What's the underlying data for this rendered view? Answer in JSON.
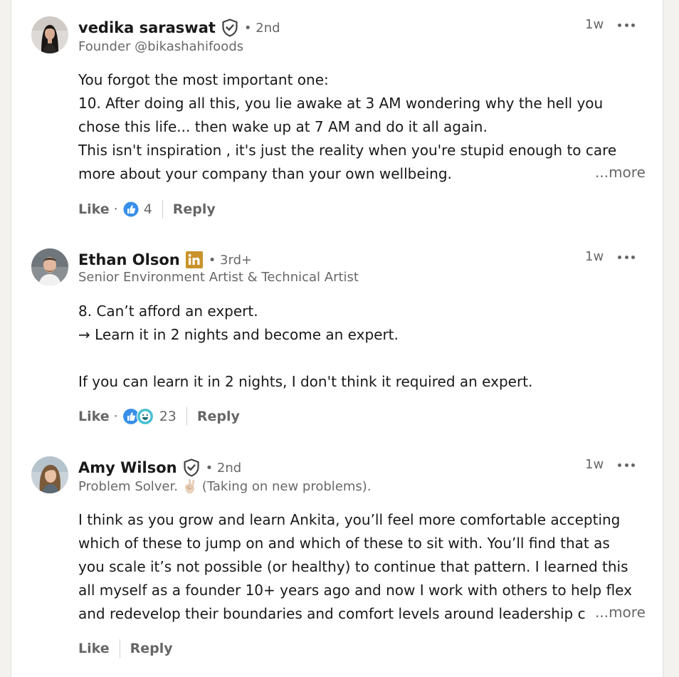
{
  "comments": [
    {
      "author": "vedika saraswat",
      "badge": "verified-shield-icon",
      "degree": "• 2nd",
      "headline": "Founder @bikashahifoods",
      "time": "1w",
      "lines": [
        "You forgot the most important one:",
        "10. After doing all this, you lie awake at 3 AM wondering why the hell you",
        "chose this life... then wake up at 7 AM and do it all again.",
        "This isn't inspiration , it's just the reality when you're stupid enough to care",
        "more about your company than your own wellbeing."
      ],
      "more": "...more",
      "like": "Like",
      "dot": "·",
      "reaction_count": "4",
      "reply": "Reply"
    },
    {
      "author": "Ethan Olson",
      "badge": "linkedin-in-icon",
      "degree": "• 3rd+",
      "headline": "Senior Environment Artist & Technical Artist",
      "time": "1w",
      "lines": [
        "8. Can’t afford an expert.",
        "→ Learn it in 2 nights and become an expert.",
        "",
        "If you can learn it in 2 nights, I don't think it required an expert."
      ],
      "like": "Like",
      "dot": "·",
      "reaction_count": "23",
      "reply": "Reply"
    },
    {
      "author": "Amy Wilson",
      "badge": "verified-shield-icon",
      "degree": "• 2nd",
      "headline": "Problem Solver. ✌🏼 (Taking on new problems).",
      "time": "1w",
      "lines": [
        "I think as you grow and learn Ankita, you’ll feel more comfortable accepting",
        "which of these to jump on and which of these to sit with. You’ll find that as",
        "you scale it’s not possible (or healthy) to continue that pattern. I learned this",
        "all myself as a founder 10+ years ago and now I work with others to help flex",
        "and redevelop their boundaries and comfort levels around leadership c"
      ],
      "more": "...more",
      "like": "Like",
      "reply": "Reply"
    }
  ],
  "colors": {
    "linkedin_gold": "#c9922a",
    "like_blue": "#378fe9",
    "funny_teal": "#44bfd3"
  }
}
